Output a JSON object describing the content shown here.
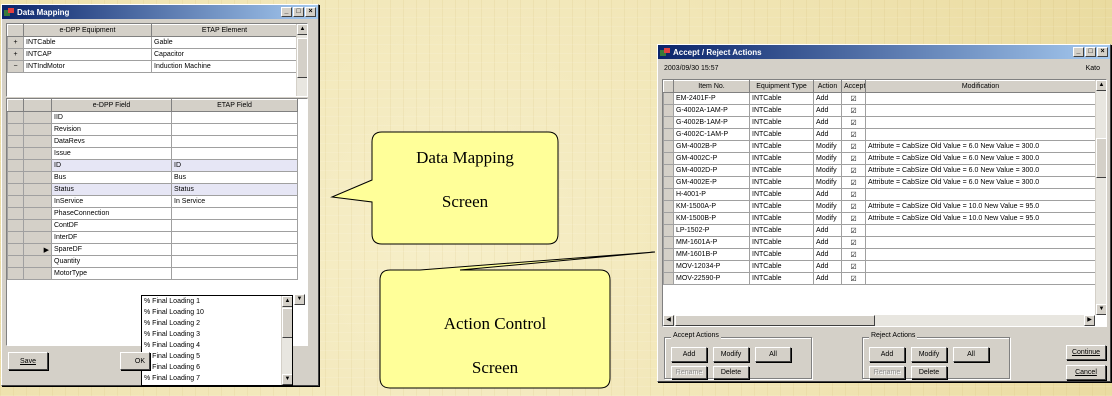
{
  "data_mapping": {
    "title": "Data Mapping",
    "equip_headers": [
      "e-DPP Equipment",
      "ETAP Element"
    ],
    "equip_rows": [
      {
        "expand": "+",
        "equipment": "INTCable",
        "element": "Gable"
      },
      {
        "expand": "+",
        "equipment": "INTCAP",
        "element": "Capacitor"
      },
      {
        "expand": "−",
        "equipment": "INTIndMotor",
        "element": "Induction Machine"
      }
    ],
    "field_headers": [
      "e-DPP Field",
      "ETAP Field"
    ],
    "field_rows": [
      {
        "field": "IID",
        "etap": ""
      },
      {
        "field": "Revision",
        "etap": ""
      },
      {
        "field": "DataRevs",
        "etap": ""
      },
      {
        "field": "Issue",
        "etap": ""
      },
      {
        "field": "ID",
        "etap": "ID"
      },
      {
        "field": "Bus",
        "etap": "Bus"
      },
      {
        "field": "Status",
        "etap": "Status"
      },
      {
        "field": "InService",
        "etap": "In Service"
      },
      {
        "field": "PhaseConnection",
        "etap": ""
      },
      {
        "field": "ContDF",
        "etap": ""
      },
      {
        "field": "InterDF",
        "etap": ""
      },
      {
        "field": "SpareDF",
        "etap": ""
      },
      {
        "field": "Quantity",
        "etap": ""
      },
      {
        "field": "MotorType",
        "etap": ""
      }
    ],
    "dropdown_options": [
      "% Final Loading 1",
      "% Final Loading 10",
      "% Final Loading 2",
      "% Final Loading 3",
      "% Final Loading 4",
      "% Final Loading 5",
      "% Final Loading 6",
      "% Final Loading 7"
    ],
    "save_label": "Save",
    "ok_label": "OK"
  },
  "callouts": {
    "data_mapping": [
      "Data Mapping",
      "Screen"
    ],
    "action_control": [
      "Action Control",
      "Screen"
    ]
  },
  "accept_reject": {
    "title": "Accept / Reject Actions",
    "datetime": "2003/09/30 15:57",
    "user": "Kato",
    "headers": [
      "Item No.",
      "Equipment Type",
      "Action",
      "Accept",
      "Modification"
    ],
    "rows": [
      {
        "item": "EM-2401F-P",
        "type": "INTCable",
        "action": "Add",
        "accept": "☑",
        "mod": ""
      },
      {
        "item": "G-4002A-1AM-P",
        "type": "INTCable",
        "action": "Add",
        "accept": "☑",
        "mod": ""
      },
      {
        "item": "G-4002B-1AM-P",
        "type": "INTCable",
        "action": "Add",
        "accept": "☑",
        "mod": ""
      },
      {
        "item": "G-4002C-1AM-P",
        "type": "INTCable",
        "action": "Add",
        "accept": "☑",
        "mod": ""
      },
      {
        "item": "GM-4002B-P",
        "type": "INTCable",
        "action": "Modify",
        "accept": "☑",
        "mod": "Attribute = CabSize Old Value = 6.0 New Value = 300.0"
      },
      {
        "item": "GM-4002C-P",
        "type": "INTCable",
        "action": "Modify",
        "accept": "☑",
        "mod": "Attribute = CabSize Old Value = 6.0 New Value = 300.0"
      },
      {
        "item": "GM-4002D-P",
        "type": "INTCable",
        "action": "Modify",
        "accept": "☑",
        "mod": "Attribute = CabSize Old Value = 6.0 New Value = 300.0"
      },
      {
        "item": "GM-4002E-P",
        "type": "INTCable",
        "action": "Modify",
        "accept": "☑",
        "mod": "Attribute = CabSize Old Value = 6.0 New Value = 300.0"
      },
      {
        "item": "H-4001-P",
        "type": "INTCable",
        "action": "Add",
        "accept": "☑",
        "mod": ""
      },
      {
        "item": "KM-1500A-P",
        "type": "INTCable",
        "action": "Modify",
        "accept": "☑",
        "mod": "Attribute = CabSize Old Value = 10.0 New Value = 95.0"
      },
      {
        "item": "KM-1500B-P",
        "type": "INTCable",
        "action": "Modify",
        "accept": "☑",
        "mod": "Attribute = CabSize Old Value = 10.0 New Value = 95.0"
      },
      {
        "item": "LP-1502-P",
        "type": "INTCable",
        "action": "Add",
        "accept": "☑",
        "mod": ""
      },
      {
        "item": "MM-1601A-P",
        "type": "INTCable",
        "action": "Add",
        "accept": "☑",
        "mod": ""
      },
      {
        "item": "MM-1601B-P",
        "type": "INTCable",
        "action": "Add",
        "accept": "☑",
        "mod": ""
      },
      {
        "item": "MOV-12034-P",
        "type": "INTCable",
        "action": "Add",
        "accept": "☑",
        "mod": ""
      },
      {
        "item": "MOV-22590-P",
        "type": "INTCable",
        "action": "Add",
        "accept": "☑",
        "mod": ""
      }
    ],
    "accept_group": {
      "label": "Accept Actions",
      "add": "Add",
      "modify": "Modify",
      "all": "All",
      "rename": "Rename",
      "delete": "Delete"
    },
    "reject_group": {
      "label": "Reject Actions",
      "add": "Add",
      "modify": "Modify",
      "all": "All",
      "rename": "Rename",
      "delete": "Delete"
    },
    "continue_label": "Continue",
    "cancel_label": "Cancel"
  }
}
